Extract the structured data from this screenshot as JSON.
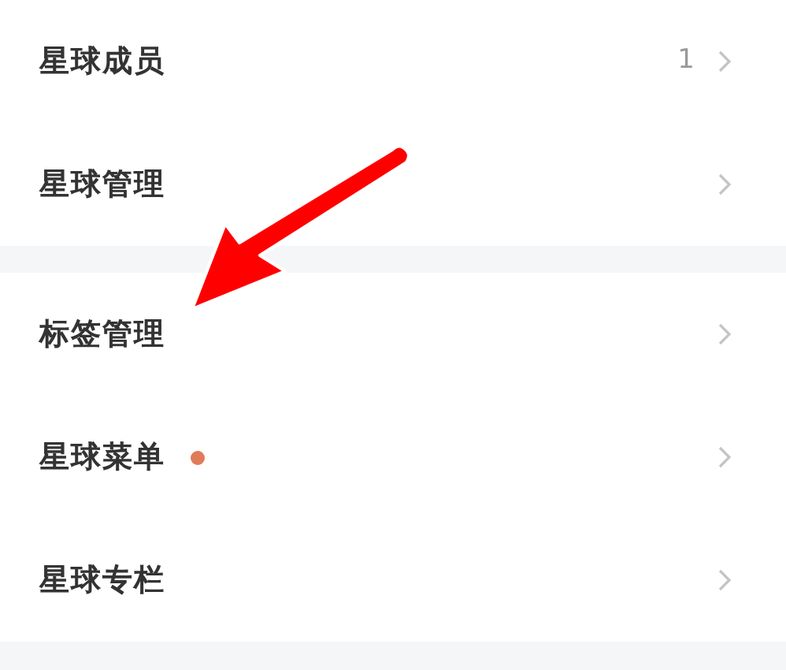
{
  "groups": [
    {
      "items": [
        {
          "label": "星球成员",
          "value": "1",
          "dot": false
        },
        {
          "label": "星球管理",
          "dot": false
        }
      ]
    },
    {
      "items": [
        {
          "label": "标签管理",
          "dot": false
        },
        {
          "label": "星球菜单",
          "dot": true
        },
        {
          "label": "星球专栏",
          "dot": false
        }
      ]
    }
  ],
  "annotation": {
    "kind": "arrow"
  }
}
